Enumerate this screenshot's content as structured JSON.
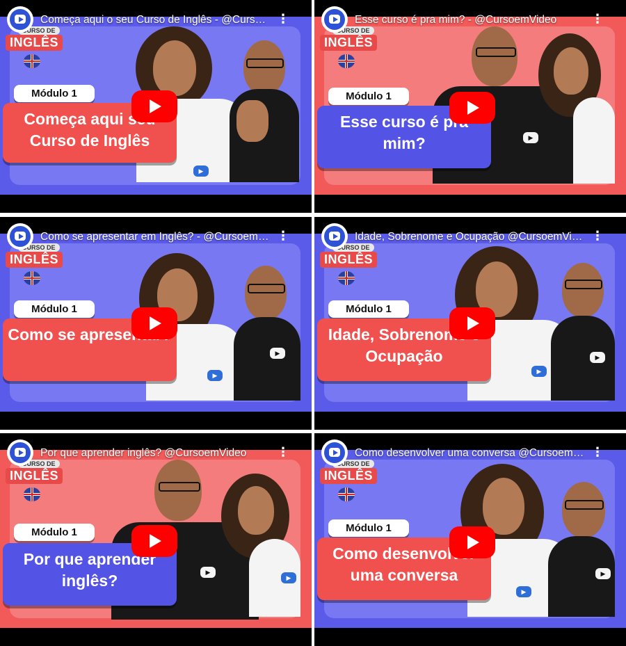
{
  "videos": [
    {
      "title": "Começa aqui o seu Curso de Inglês - @CursoemVideo",
      "module": "Módulo 1",
      "card_title": "Começa aqui seu Curso de Inglês",
      "badge_course": "CURSO DE",
      "badge_language": "INGLÊS",
      "theme": "blue",
      "card_color": "red"
    },
    {
      "title": "Esse curso é pra mim? - @CursoemVideo",
      "module": "Módulo 1",
      "card_title": "Esse curso é pra mim?",
      "badge_course": "CURSO DE",
      "badge_language": "INGLÊS",
      "theme": "red",
      "card_color": "blue"
    },
    {
      "title": "Como se apresentar em Inglês? - @CursoemVideo",
      "module": "Módulo 1",
      "card_title": "Como se apresentar?",
      "badge_course": "CURSO DE",
      "badge_language": "INGLÊS",
      "theme": "blue",
      "card_color": "red"
    },
    {
      "title": "Idade, Sobrenome e Ocupação @CursoemVideo",
      "module": "Módulo 1",
      "card_title": "Idade, Sobrenome e Ocupação",
      "badge_course": "CURSO DE",
      "badge_language": "INGLÊS",
      "theme": "blue",
      "card_color": "red"
    },
    {
      "title": "Por que aprender inglês? @CursoemVideo",
      "module": "Módulo 1",
      "card_title": "Por que aprender inglês?",
      "badge_course": "CURSO DE",
      "badge_language": "INGLÊS",
      "theme": "red",
      "card_color": "blue"
    },
    {
      "title": "Como desenvolver uma conversa @CursoemVideo",
      "module": "Módulo 1",
      "card_title": "Como desenvolver uma conversa",
      "badge_course": "CURSO DE",
      "badge_language": "INGLÊS",
      "theme": "blue",
      "card_color": "red"
    }
  ],
  "icons": {
    "channel": "channel-avatar-icon",
    "menu": "more-vert-icon",
    "play": "play-button-icon",
    "flag": "uk-us-flag-icon"
  },
  "colors": {
    "blue_frame": "#5b5bea",
    "red_frame": "#f25a5a",
    "play_red": "#ff0000"
  }
}
